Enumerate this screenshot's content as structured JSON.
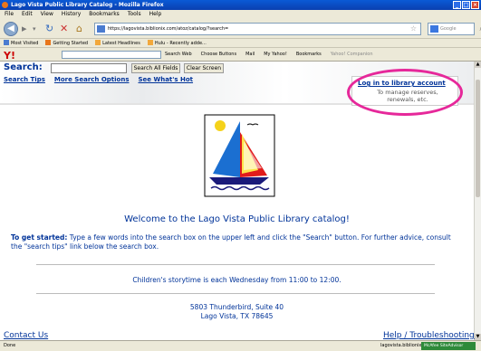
{
  "window": {
    "title": "Lago Vista Public Library Catalog - Mozilla Firefox"
  },
  "menu": [
    "File",
    "Edit",
    "View",
    "History",
    "Bookmarks",
    "Tools",
    "Help"
  ],
  "address_bar": {
    "url": "https://lagovista.biblionix.com/atoz/catalog/?search=",
    "search_placeholder": "Google"
  },
  "bookmarks": [
    "Most Visited",
    "Getting Started",
    "Latest Headlines",
    "Hulu - Recently adde..."
  ],
  "yahoo_toolbar": {
    "logo": "Y!",
    "items": [
      "Search Web",
      "Choose Buttons",
      "Mail",
      "My Yahoo!",
      "Bookmarks",
      "Yahoo! Companion"
    ]
  },
  "catalog": {
    "search_label": "Search:",
    "search_all_button": "Search All Fields",
    "clear_button": "Clear Screen",
    "links": [
      "Search Tips",
      "More Search Options",
      "See What's Hot"
    ],
    "login_link": "Log in to library account",
    "login_sub": "To manage reserves, renewals, etc.",
    "welcome": "Welcome to the Lago Vista Public Library catalog!",
    "get_started_label": "To get started:",
    "get_started_text": "Type a few words into the search box on the upper left and click the \"Search\" button. For further advice, consult the \"search tips\" link below the search box.",
    "storytime": "Children's storytime is each Wednesday from 11:00 to 12:00.",
    "address_line1": "5803 Thunderbird, Suite 40",
    "address_line2": "Lago Vista, TX 78645",
    "contact_us": "Contact Us",
    "help": "Help / Troubleshooting"
  },
  "status": {
    "text": "Done",
    "host": "lagovista.biblionix.com",
    "addon": "McAfee SiteAdvisor"
  },
  "colors": {
    "link": "#003399",
    "highlight_ellipse": "#e6289a"
  }
}
